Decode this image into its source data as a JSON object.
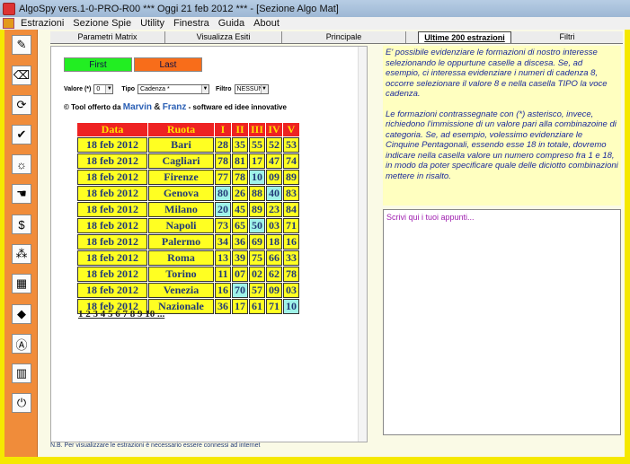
{
  "window": {
    "title": "AlgoSpy vers.1-0-PRO-R00  ***  Oggi 21 feb 2012  ***  - [Sezione Algo Mat]"
  },
  "menu": [
    "Estrazioni",
    "Sezione Spie",
    "Utility",
    "Finestra",
    "Guida",
    "About"
  ],
  "tabs": [
    "Parametri Matrix",
    "Visualizza Esiti",
    "Principale",
    "Ultime 200 estrazioni",
    "Filtri"
  ],
  "controls": {
    "first_label": "First",
    "last_label": "Last",
    "valore_label": "Valore (*)",
    "valore_value": "0",
    "tipo_label": "Tipo",
    "tipo_value": "Cadenza *",
    "filtro_label": "Filtro",
    "filtro_value": "NESSUNO"
  },
  "credit": {
    "prefix": "© Tool offerto da",
    "name1": "Marvin",
    "amp": "&",
    "name2": "Franz",
    "suffix": "- software ed idee innovative"
  },
  "table": {
    "headers": [
      "Data",
      "Ruota",
      "I",
      "II",
      "III",
      "IV",
      "V"
    ],
    "rows": [
      {
        "date": "18 feb 2012",
        "ruota": "Bari",
        "nums": [
          "28",
          "35",
          "55",
          "52",
          "53"
        ],
        "hl": []
      },
      {
        "date": "18 feb 2012",
        "ruota": "Cagliari",
        "nums": [
          "78",
          "81",
          "17",
          "47",
          "74"
        ],
        "hl": []
      },
      {
        "date": "18 feb 2012",
        "ruota": "Firenze",
        "nums": [
          "77",
          "78",
          "10",
          "09",
          "89"
        ],
        "hl": [
          2
        ]
      },
      {
        "date": "18 feb 2012",
        "ruota": "Genova",
        "nums": [
          "80",
          "26",
          "88",
          "40",
          "83"
        ],
        "hl": [
          0,
          3
        ]
      },
      {
        "date": "18 feb 2012",
        "ruota": "Milano",
        "nums": [
          "20",
          "45",
          "89",
          "23",
          "84"
        ],
        "hl": [
          0
        ]
      },
      {
        "date": "18 feb 2012",
        "ruota": "Napoli",
        "nums": [
          "73",
          "65",
          "50",
          "03",
          "71"
        ],
        "hl": [
          2
        ]
      },
      {
        "date": "18 feb 2012",
        "ruota": "Palermo",
        "nums": [
          "34",
          "36",
          "69",
          "18",
          "16"
        ],
        "hl": []
      },
      {
        "date": "18 feb 2012",
        "ruota": "Roma",
        "nums": [
          "13",
          "39",
          "75",
          "66",
          "33"
        ],
        "hl": []
      },
      {
        "date": "18 feb 2012",
        "ruota": "Torino",
        "nums": [
          "11",
          "07",
          "02",
          "62",
          "78"
        ],
        "hl": []
      },
      {
        "date": "18 feb 2012",
        "ruota": "Venezia",
        "nums": [
          "16",
          "70",
          "57",
          "09",
          "03"
        ],
        "hl": [
          1
        ]
      },
      {
        "date": "18 feb 2012",
        "ruota": "Nazionale",
        "nums": [
          "36",
          "17",
          "61",
          "71",
          "10"
        ],
        "hl": [
          4
        ]
      }
    ]
  },
  "pages": "1 2 3 4 5 6 7 8 9 10 ...",
  "info": {
    "p1": "E' possibile evidenziare le formazioni di nostro interesse selezionando le oppurtune caselle a discesa. Se, ad esempio, ci interessa evidenziare i numeri di cadenza 8, occorre selezionare il valore 8 e nella casella TIPO la voce cadenza.",
    "p2": "Le formazioni contrassegnate con (*) asterisco, invece, richiedono l'immissione di un valore pari alla combinazoine di categoria. Se, ad esempio, volessimo evidenziare le Cinquine Pentagonali, essendo esse 18 in totale, dovremo indicare nella casella valore un numero compreso fra 1 e 18, in modo da poter specificare quale delle diciotto combinazioni mettere in risalto."
  },
  "notes_placeholder": "Scrivi qui i tuoi appunti...",
  "footer": "N.B. Per visualizzare le estrazioni è necessario essere connessi ad internet",
  "sidebar_icons": [
    "edit-icon",
    "eraser-icon",
    "refresh-icon",
    "check-icon",
    "bulb-icon",
    "hand-icon",
    "money-icon",
    "tree-icon",
    "grid-icon",
    "drop-icon",
    "a-icon",
    "book-icon",
    "power-icon"
  ]
}
